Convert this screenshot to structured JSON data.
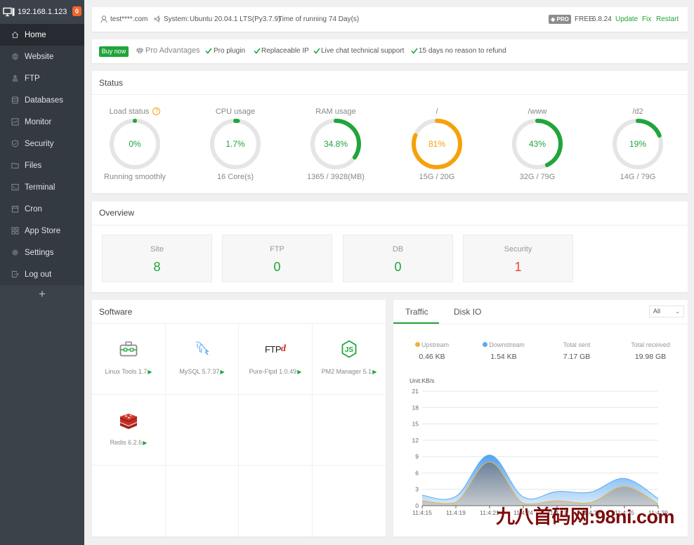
{
  "sidebar": {
    "host": "192.168.1.123",
    "badge": "0",
    "items": [
      {
        "label": "Home",
        "icon": "home-icon",
        "active": true
      },
      {
        "label": "Website",
        "icon": "globe-icon"
      },
      {
        "label": "FTP",
        "icon": "ftp-icon"
      },
      {
        "label": "Databases",
        "icon": "database-icon"
      },
      {
        "label": "Monitor",
        "icon": "monitor-icon"
      },
      {
        "label": "Security",
        "icon": "shield-icon"
      },
      {
        "label": "Files",
        "icon": "folder-icon"
      },
      {
        "label": "Terminal",
        "icon": "terminal-icon"
      },
      {
        "label": "Cron",
        "icon": "calendar-icon"
      },
      {
        "label": "App Store",
        "icon": "grid-icon"
      },
      {
        "label": "Settings",
        "icon": "gear-icon"
      },
      {
        "label": "Log out",
        "icon": "logout-icon"
      }
    ],
    "add_label": "+"
  },
  "header": {
    "user": "test****.com",
    "system_label": "System:",
    "system_value": "Ubuntu 20.04.1 LTS(Py3.7.9)",
    "uptime": "Time of running 74 Day(s)",
    "pro_badge": "PRO",
    "edition": "FREE",
    "version": "6.8.24",
    "update": "Update",
    "fix": "Fix",
    "restart": "Restart"
  },
  "promo": {
    "buy_now": "Buy now",
    "pro_advantages": "Pro Advantages",
    "features": [
      "Pro plugin",
      "Replaceable IP",
      "Live chat technical support",
      "15 days no reason to refund"
    ]
  },
  "status": {
    "title": "Status",
    "gauges": [
      {
        "label": "Load status",
        "value": 0,
        "display": "0%",
        "sub": "Running smoothly",
        "color": "#20a53a"
      },
      {
        "label": "CPU usage",
        "value": 1.7,
        "display": "1.7%",
        "sub": "16 Core(s)",
        "color": "#20a53a"
      },
      {
        "label": "RAM usage",
        "value": 34.8,
        "display": "34.8%",
        "sub": "1365 / 3928(MB)",
        "color": "#20a53a"
      },
      {
        "label": "/",
        "value": 81,
        "display": "81%",
        "sub": "15G / 20G",
        "color": "#f7a10a"
      },
      {
        "label": "/www",
        "value": 43,
        "display": "43%",
        "sub": "32G / 79G",
        "color": "#20a53a"
      },
      {
        "label": "/d2",
        "value": 19,
        "display": "19%",
        "sub": "14G / 79G",
        "color": "#20a53a"
      }
    ]
  },
  "overview": {
    "title": "Overview",
    "cards": [
      {
        "label": "Site",
        "value": "8",
        "color": "#20a53a"
      },
      {
        "label": "FTP",
        "value": "0",
        "color": "#20a53a"
      },
      {
        "label": "DB",
        "value": "0",
        "color": "#20a53a"
      },
      {
        "label": "Security",
        "value": "1",
        "color": "#e8472c"
      }
    ]
  },
  "software": {
    "title": "Software",
    "items": [
      {
        "name": "Linux Tools 1.7",
        "icon": "toolbox-icon"
      },
      {
        "name": "MySQL 5.7.37",
        "icon": "mysql-dolphin-icon"
      },
      {
        "name": "Pure-Ftpd 1.0.49",
        "icon": "ftp-logo-icon"
      },
      {
        "name": "PM2 Manager 5.1",
        "icon": "nodejs-icon"
      },
      {
        "name": "Redis 6.2.6",
        "icon": "redis-icon"
      }
    ],
    "play_glyph": "▶",
    "ftp_logo_text": "FTP",
    "ftp_logo_mark": "d",
    "js_text": "JS"
  },
  "traffic": {
    "tabs": [
      "Traffic",
      "Disk IO"
    ],
    "active_tab": "Traffic",
    "select_value": "All",
    "select_chevron": "⌄",
    "stats": [
      {
        "label": "Upstream",
        "value": "0.46 KB",
        "dot": "#f0b13b"
      },
      {
        "label": "Downstream",
        "value": "1.54 KB",
        "dot": "#5aa9f0"
      },
      {
        "label": "Total sent",
        "value": "7.17 GB"
      },
      {
        "label": "Total received",
        "value": "19.98 GB"
      }
    ]
  },
  "chart_data": {
    "type": "area",
    "title": "",
    "unit": "Unit:KB/s",
    "xlabel": "",
    "ylabel": "KB/s",
    "x": [
      "11:4:15",
      "11:4:19",
      "11:4:21",
      "11:4:24",
      "11:4:27",
      "11:4:30",
      "11:4:35",
      "11:4:39"
    ],
    "yticks": [
      0,
      3,
      6,
      9,
      12,
      15,
      18,
      21
    ],
    "ylim": [
      0,
      21
    ],
    "grid": true,
    "series": [
      {
        "name": "Downstream",
        "color": "#5aa9f0",
        "values": [
          1.9,
          1.7,
          9.3,
          1.6,
          2.6,
          2.5,
          5.0,
          1.3
        ]
      },
      {
        "name": "Upstream",
        "color": "#f0b13b",
        "values": [
          0.9,
          0.6,
          8.0,
          0.4,
          0.9,
          0.6,
          3.5,
          0.3
        ]
      }
    ]
  },
  "colors": {
    "accent": "#20a53a",
    "warning": "#f7a10a",
    "danger": "#e8472c"
  },
  "watermark": "九八首码网:98ni.com"
}
